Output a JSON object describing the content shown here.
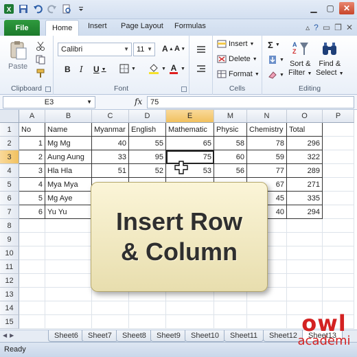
{
  "title_bar": {
    "qat": [
      "excel-logo-icon",
      "save-icon",
      "undo-icon",
      "redo-icon",
      "print-preview-icon",
      "customize-qat-icon"
    ],
    "window_controls": [
      "minimize-icon",
      "maximize-icon",
      "close-icon"
    ]
  },
  "tabs": {
    "file": "File",
    "items": [
      "Home",
      "Insert",
      "Page Layout",
      "Formulas"
    ],
    "active": "Home"
  },
  "ribbon": {
    "clipboard": {
      "label": "Clipboard",
      "paste": "Paste"
    },
    "font": {
      "label": "Font",
      "name": "Calibri",
      "size": "11"
    },
    "cells": {
      "label": "Cells",
      "insert": "Insert",
      "delete": "Delete",
      "format": "Format"
    },
    "editing": {
      "label": "Editing",
      "sort1": "Sort &",
      "sort2": "Filter",
      "find1": "Find &",
      "find2": "Select"
    }
  },
  "formula_bar": {
    "name_box": "E3",
    "fx": "fx",
    "value": "75"
  },
  "grid": {
    "columns": [
      "A",
      "B",
      "C",
      "D",
      "E",
      "M",
      "N",
      "O",
      "P"
    ],
    "selected_column": "E",
    "selected_row": "3",
    "row_numbers": [
      "1",
      "2",
      "3",
      "4",
      "5",
      "6",
      "7",
      "8",
      "9",
      "10",
      "11",
      "12",
      "13",
      "14",
      "15"
    ],
    "headers": [
      "No",
      "Name",
      "Myanmar",
      "English",
      "Mathematic",
      "Physic",
      "Chemistry",
      "Total"
    ],
    "rows": [
      [
        "1",
        "Mg Mg",
        "40",
        "55",
        "65",
        "58",
        "78",
        "296"
      ],
      [
        "2",
        "Aung Aung",
        "33",
        "95",
        "75",
        "60",
        "59",
        "322"
      ],
      [
        "3",
        "Hla Hla",
        "51",
        "52",
        "53",
        "56",
        "77",
        "289"
      ],
      [
        "4",
        "Mya Mya",
        "",
        "",
        "",
        "",
        "67",
        "271"
      ],
      [
        "5",
        "Mg Aye",
        "",
        "",
        "",
        "",
        "45",
        "335"
      ],
      [
        "6",
        "Yu Yu",
        "",
        "",
        "",
        "",
        "40",
        "294"
      ]
    ]
  },
  "overlay": {
    "line1": "Insert Row",
    "line2": "& Column"
  },
  "sheets": {
    "tabs": [
      "Sheet6",
      "Sheet7",
      "Sheet8",
      "Sheet9",
      "Sheet10",
      "Sheet11",
      "Sheet12",
      "Sheet13"
    ],
    "active": "Sheet13"
  },
  "status": "Ready",
  "logo": {
    "line1": "owl",
    "line2": "academi"
  }
}
